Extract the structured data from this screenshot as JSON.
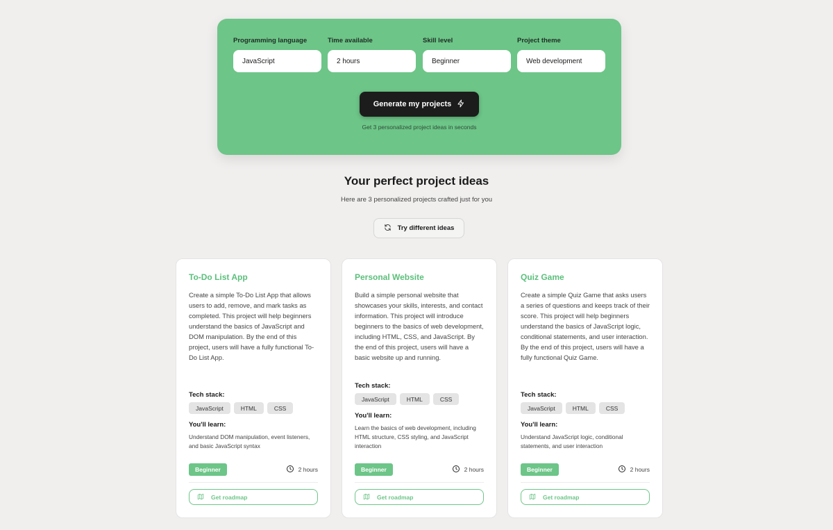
{
  "form": {
    "fields": [
      {
        "label": "Programming language",
        "value": "JavaScript"
      },
      {
        "label": "Time available",
        "value": "2 hours"
      },
      {
        "label": "Skill level",
        "value": "Beginner"
      },
      {
        "label": "Project theme",
        "value": "Web development"
      }
    ],
    "generate_label": "Generate my projects",
    "generate_icon": "lightning-icon",
    "hint": "Get 3 personalized project ideas in seconds"
  },
  "results": {
    "title": "Your perfect project ideas",
    "subtitle": "Here are 3 personalized projects crafted just for you",
    "retry_label": "Try different ideas",
    "retry_icon": "refresh-icon"
  },
  "labels": {
    "tech_stack": "Tech stack:",
    "learn": "You'll learn:",
    "roadmap": "Get roadmap"
  },
  "colors": {
    "accent": "#6dc588",
    "title_green": "#5bbf7b",
    "dark_button": "#1c1c1c"
  },
  "cards": [
    {
      "title": "To-Do List App",
      "description": "Create a simple To-Do List App that allows users to add, remove, and mark tasks as completed. This project will help beginners understand the basics of JavaScript and DOM manipulation. By the end of this project, users will have a fully functional To-Do List App.",
      "tech": [
        "JavaScript",
        "HTML",
        "CSS"
      ],
      "learn": "Understand DOM manipulation, event listeners, and basic JavaScript syntax",
      "level": "Beginner",
      "time": "2 hours"
    },
    {
      "title": "Personal Website",
      "description": "Build a simple personal website that showcases your skills, interests, and contact information. This project will introduce beginners to the basics of web development, including HTML, CSS, and JavaScript. By the end of this project, users will have a basic website up and running.",
      "tech": [
        "JavaScript",
        "HTML",
        "CSS"
      ],
      "learn": "Learn the basics of web development, including HTML structure, CSS styling, and JavaScript interaction",
      "level": "Beginner",
      "time": "2 hours"
    },
    {
      "title": "Quiz Game",
      "description": "Create a simple Quiz Game that asks users a series of questions and keeps track of their score. This project will help beginners understand the basics of JavaScript logic, conditional statements, and user interaction. By the end of this project, users will have a fully functional Quiz Game.",
      "tech": [
        "JavaScript",
        "HTML",
        "CSS"
      ],
      "learn": "Understand JavaScript logic, conditional statements, and user interaction",
      "level": "Beginner",
      "time": "2 hours"
    }
  ]
}
